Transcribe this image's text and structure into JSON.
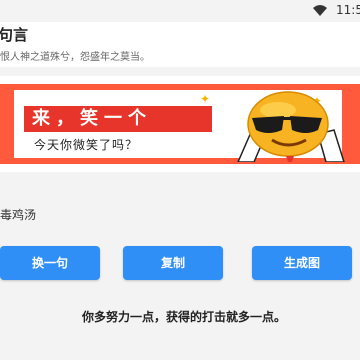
{
  "status": {
    "time": "11:5",
    "wifi_icon": "wifi-icon"
  },
  "header": {
    "title": "句言",
    "subtitle": "恨人神之道殊兮，怨盛年之莫当。"
  },
  "banner": {
    "headline": "来，笑一个",
    "subline": "今天你微笑了吗？",
    "accent_color": "#ff5a3c",
    "headline_bg": "#e8352b"
  },
  "category": {
    "label": "毒鸡汤"
  },
  "buttons": {
    "change": "换一句",
    "copy": "复制",
    "generate": "生成图"
  },
  "quote": {
    "text": "你多努力一点，获得的打击就多一点。"
  },
  "colors": {
    "button": "#2f8ff6",
    "background": "#f3f3f3"
  }
}
